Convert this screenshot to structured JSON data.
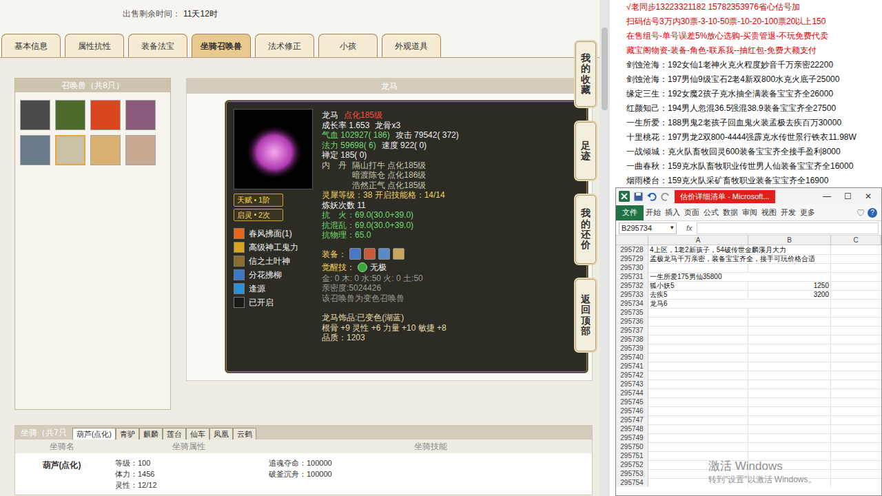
{
  "sale_timer": {
    "label": "出售剩余时间：",
    "value": "11天12时"
  },
  "tabs": [
    {
      "label": "基本信息",
      "selected": false
    },
    {
      "label": "属性抗性",
      "selected": false
    },
    {
      "label": "装备法宝",
      "selected": false
    },
    {
      "label": "坐骑召唤兽",
      "selected": true
    },
    {
      "label": "法术修正",
      "selected": false
    },
    {
      "label": "小孩",
      "selected": false
    },
    {
      "label": "外观道具",
      "selected": false
    }
  ],
  "side_buttons": [
    "我的收藏",
    "足迹",
    "我的还价",
    "返回顶部"
  ],
  "pets_panel": {
    "title": "召唤兽（共8只）",
    "pets": [
      {
        "selected": false
      },
      {
        "selected": false
      },
      {
        "selected": false
      },
      {
        "selected": false
      },
      {
        "selected": false
      },
      {
        "selected": true
      },
      {
        "selected": false
      },
      {
        "selected": false
      }
    ]
  },
  "pet": {
    "title": "龙马",
    "badges": [
      {
        "label": "天赋",
        "value": "1阶"
      },
      {
        "label": "启灵",
        "value": "2次"
      }
    ],
    "skills": [
      {
        "label": "春风拂面(1)",
        "color": "#e8661e"
      },
      {
        "label": "高级神工鬼力",
        "color": "#d9a520"
      },
      {
        "label": "信之土叶神",
        "color": "#8b6b2e"
      },
      {
        "label": "分花拂柳",
        "color": "#3b78c8"
      },
      {
        "label": "逢源",
        "color": "#2d8fd8"
      },
      {
        "label": "已开启",
        "color": "#1a1a1a"
      }
    ],
    "header": [
      {
        "text": "龙马",
        "kind": "white"
      },
      {
        "text": "点化185级",
        "kind": "red"
      }
    ],
    "stats": [
      [
        {
          "text": "成长率 1.653",
          "kind": "white"
        },
        {
          "text": "龙骨x3",
          "kind": "white"
        }
      ],
      [
        {
          "text": "气血 102927( 186)",
          "kind": "green"
        },
        {
          "text": "攻击 79542( 372)",
          "kind": "white"
        }
      ],
      [
        {
          "text": "法力 59698( 6)",
          "kind": "green"
        },
        {
          "text": "速度 922( 0)",
          "kind": "white"
        }
      ],
      [
        {
          "text": "禅定 185( 0)",
          "kind": "white"
        }
      ]
    ],
    "neidan": {
      "label": "内　丹",
      "items": [
        "隔山打牛 点化185级",
        "暗渡陈仓 点化186级",
        "浩然正气 点化185级"
      ]
    },
    "stats2": [
      [
        {
          "text": "灵犀等级：38 开启技能格：14/14",
          "kind": "yellow"
        }
      ],
      [
        {
          "text": "炼妖次数 11",
          "kind": "white"
        }
      ],
      [
        {
          "text": "抗　火：69.0(30.0+39.0)",
          "kind": "green"
        }
      ],
      [
        {
          "text": "抗混乱：69.0(30.0+39.0)",
          "kind": "green"
        }
      ],
      [
        {
          "text": "抗物理：65.0",
          "kind": "green"
        }
      ]
    ],
    "equip": {
      "label": "装备："
    },
    "awaken": {
      "label": "觉醒技：",
      "skill": "无极"
    },
    "stats3": [
      [
        {
          "text": "金: 0 木: 0 水:50 火: 0 土:50",
          "kind": "gray"
        }
      ],
      [
        {
          "text": "亲密度:5024426",
          "kind": "gray"
        }
      ],
      [
        {
          "text": "该召唤兽为变色召唤兽",
          "kind": "gray"
        }
      ]
    ],
    "stats4": [
      [
        {
          "text": "龙马饰品:已变色(湖蓝)",
          "kind": "cream"
        }
      ],
      [
        {
          "text": "根骨 +9 灵性 +6 力量 +10 敏捷 +8",
          "kind": "cream"
        }
      ],
      [
        {
          "text": "品质：1203",
          "kind": "cream"
        }
      ]
    ]
  },
  "mounts": {
    "title": "坐骑（共7只",
    "tabs": [
      {
        "label": "葫芦(点化)",
        "selected": true
      },
      {
        "label": "青驴",
        "selected": false
      },
      {
        "label": "麒麟",
        "selected": false
      },
      {
        "label": "莲台",
        "selected": false
      },
      {
        "label": "仙车",
        "selected": false
      },
      {
        "label": "凤凰",
        "selected": false
      },
      {
        "label": "云鹤",
        "selected": false
      }
    ],
    "headers": [
      "坐骑名",
      "坐骑属性",
      "坐骑技能"
    ],
    "row": {
      "name": "葫芦(点化)",
      "attrs": [
        "等级：100",
        "体力：1456",
        "灵性：12/12"
      ],
      "skills": [
        "追魂夺命：100000",
        "破釜沉舟：100000"
      ]
    }
  },
  "notes": [
    {
      "text": "√老同步13223321182 15782353976省心估号加",
      "kind": "red"
    },
    {
      "text": "扫码估号3万内30票-3-10-50票-10-20-100票20以上150",
      "kind": "red"
    },
    {
      "text": "在售组号-单号误差5%放心选购-买贵管退-不玩免费代卖",
      "kind": "red"
    },
    {
      "text": "藏宝阁物资-装备-角色-联系我--抽红包-免费大额支付",
      "kind": "red"
    },
    {
      "text": "剑蚀沧海：192女仙1老神火克火程度妙音千万亲密22200",
      "kind": "black"
    },
    {
      "text": "剑蚀沧海：197男仙9级宝石2老4新双800水克火底子25000",
      "kind": "black"
    },
    {
      "text": "缘定三生：192女魔2孩子克水抽全满装备宝宝齐全26000",
      "kind": "black"
    },
    {
      "text": "红颜知己：194男人忽混36.5强混38.9装备宝宝齐全27500",
      "kind": "black"
    },
    {
      "text": "一生所爱：188男鬼2老孩子回血鬼火装孟极去疾百万30000",
      "kind": "black"
    },
    {
      "text": "十里桃花：197男龙2双800-4444强霹克水传世景行铁衣11.98W",
      "kind": "black"
    },
    {
      "text": "一战倾城：克火队畜牧回灵600装备宝宝齐全接手盈利8000",
      "kind": "black"
    },
    {
      "text": "一曲春秋：159克水队畜牧职业传世男人仙装备宝宝齐全16000",
      "kind": "black"
    },
    {
      "text": "烟雨楼台：159克火队采矿畜牧职业装备宝宝齐全16900",
      "kind": "black"
    }
  ],
  "excel": {
    "title": "估价详细清单 - Microsoft...",
    "controls": [
      "—",
      "☐",
      "✕"
    ],
    "ribbon": [
      {
        "label": "文件",
        "selected": true
      },
      {
        "label": "开始",
        "selected": false
      },
      {
        "label": "插入",
        "selected": false
      },
      {
        "label": "页面",
        "selected": false
      },
      {
        "label": "公式",
        "selected": false
      },
      {
        "label": "数据",
        "selected": false
      },
      {
        "label": "审阅",
        "selected": false
      },
      {
        "label": "视图",
        "selected": false
      },
      {
        "label": "开发",
        "selected": false
      },
      {
        "label": "更多",
        "selected": false
      }
    ],
    "ribbon_extras": [
      "♡",
      "?"
    ],
    "name_box": "B295734",
    "dropdown": "▾",
    "fx": "fx",
    "columns": [
      "A",
      "B",
      "C"
    ],
    "rows": [
      {
        "num": "295728",
        "a": "4上区，1老2新孩子，54破传世金麟溪月大力",
        "b": ""
      },
      {
        "num": "295729",
        "a": "孟极龙马千万亲密，装备宝宝齐全，接手可玩价格合适",
        "b": ""
      },
      {
        "num": "295730",
        "a": "",
        "b": ""
      },
      {
        "num": "295731",
        "a": "一生所爱175男仙35800",
        "b": ""
      },
      {
        "num": "295732",
        "a": "狐小妖5",
        "b": "1250"
      },
      {
        "num": "295733",
        "a": "去疾5",
        "b": "3200"
      },
      {
        "num": "295734",
        "a": "龙马6",
        "b": ""
      },
      {
        "num": "295735",
        "a": "",
        "b": ""
      },
      {
        "num": "295736",
        "a": "",
        "b": ""
      },
      {
        "num": "295737",
        "a": "",
        "b": ""
      },
      {
        "num": "295738",
        "a": "",
        "b": ""
      },
      {
        "num": "295739",
        "a": "",
        "b": ""
      },
      {
        "num": "295740",
        "a": "",
        "b": ""
      },
      {
        "num": "295741",
        "a": "",
        "b": ""
      },
      {
        "num": "295742",
        "a": "",
        "b": ""
      },
      {
        "num": "295743",
        "a": "",
        "b": ""
      },
      {
        "num": "295744",
        "a": "",
        "b": ""
      },
      {
        "num": "295745",
        "a": "",
        "b": ""
      },
      {
        "num": "295746",
        "a": "",
        "b": ""
      },
      {
        "num": "295747",
        "a": "",
        "b": ""
      },
      {
        "num": "295748",
        "a": "",
        "b": ""
      },
      {
        "num": "295749",
        "a": "",
        "b": ""
      },
      {
        "num": "295750",
        "a": "",
        "b": ""
      },
      {
        "num": "295751",
        "a": "",
        "b": ""
      },
      {
        "num": "295752",
        "a": "",
        "b": ""
      },
      {
        "num": "295753",
        "a": "",
        "b": ""
      },
      {
        "num": "295754",
        "a": "",
        "b": ""
      }
    ]
  },
  "watermark": {
    "title": "激活 Windows",
    "subtitle": "转到\"设置\"以激活 Windows。"
  }
}
